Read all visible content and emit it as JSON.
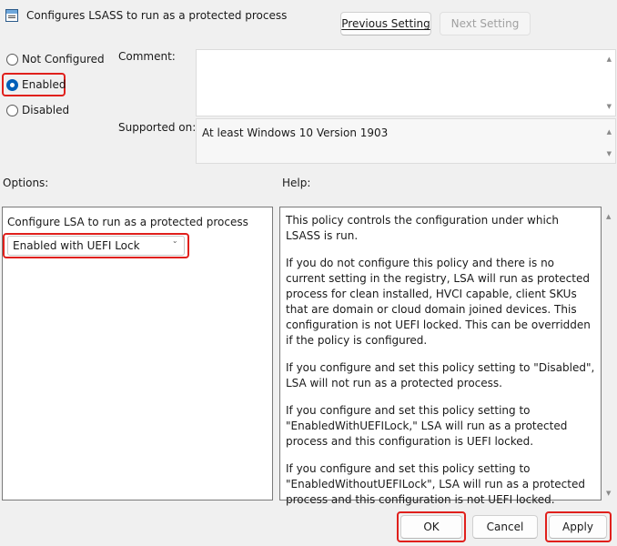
{
  "window": {
    "title": "Configures LSASS to run as a protected process"
  },
  "nav": {
    "previous_label": "Previous Setting",
    "next_label": "Next Setting"
  },
  "state": {
    "options": [
      {
        "label": "Not Configured",
        "selected": false
      },
      {
        "label": "Enabled",
        "selected": true
      },
      {
        "label": "Disabled",
        "selected": false
      }
    ]
  },
  "comment": {
    "label": "Comment:",
    "value": ""
  },
  "supported": {
    "label": "Supported on:",
    "value": "At least Windows 10 Version 1903"
  },
  "options_section": {
    "header": "Options:",
    "setting_label": "Configure LSA to run as a protected process",
    "dropdown_value": "Enabled with UEFI Lock"
  },
  "help_section": {
    "header": "Help:",
    "paragraphs": [
      "This policy controls the configuration under which LSASS is run.",
      "If you do not configure this policy and there is no current setting in the registry, LSA will run as protected process for clean installed, HVCI capable, client SKUs that are domain or cloud domain joined devices. This configuration is not UEFI locked. This can be overridden if the policy is configured.",
      "If you configure and set this policy setting to \"Disabled\", LSA will not run as a protected process.",
      "If you configure and set this policy setting to \"EnabledWithUEFILock,\" LSA will run as a protected process and this configuration is UEFI locked.",
      "If you configure and set this policy setting to \"EnabledWithoutUEFILock\", LSA will run as a protected process and this configuration is not UEFI locked."
    ]
  },
  "footer": {
    "ok_label": "OK",
    "cancel_label": "Cancel",
    "apply_label": "Apply"
  },
  "colors": {
    "highlight": "#e0201c",
    "accent": "#005fb8"
  }
}
